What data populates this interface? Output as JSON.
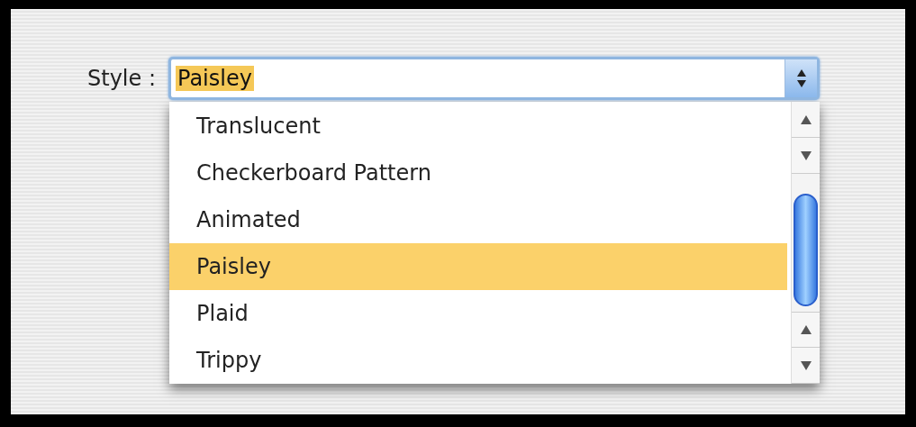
{
  "style_field": {
    "label": "Style :",
    "value": "Paisley"
  },
  "options": [
    {
      "label": "Translucent",
      "selected": false
    },
    {
      "label": "Checkerboard Pattern",
      "selected": false
    },
    {
      "label": "Animated",
      "selected": false
    },
    {
      "label": "Paisley",
      "selected": true
    },
    {
      "label": "Plaid",
      "selected": false
    },
    {
      "label": "Trippy",
      "selected": false
    }
  ]
}
